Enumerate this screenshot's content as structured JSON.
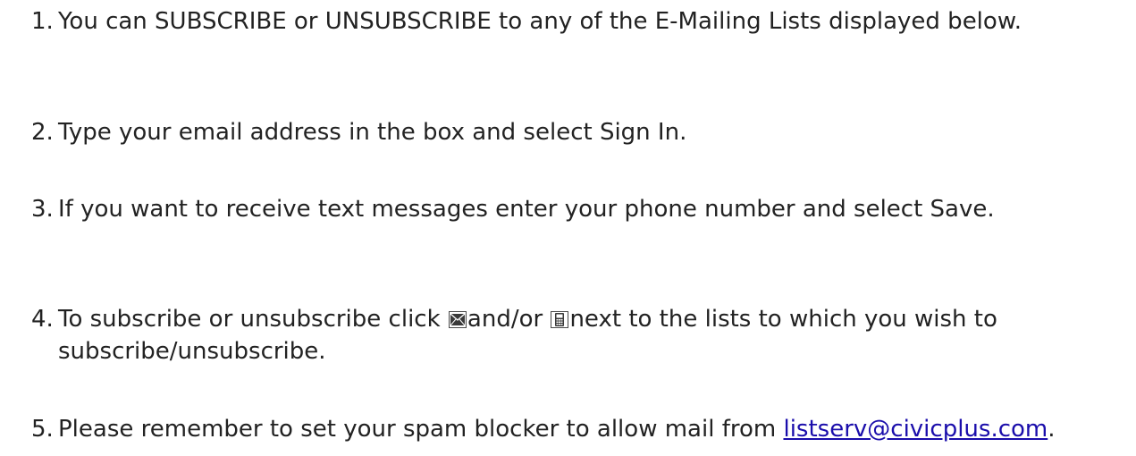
{
  "steps": [
    {
      "number": "1.",
      "text": "You can SUBSCRIBE or UNSUBSCRIBE to any of the E-Mailing Lists displayed below."
    },
    {
      "number": "2.",
      "text": "Type your email address in the box and select Sign In."
    },
    {
      "number": "3.",
      "text": "If you want to receive text messages enter your phone number and select Save."
    },
    {
      "number": "4.",
      "text_before": "To subscribe or unsubscribe click ",
      "text_middle": "and/or ",
      "text_after": "next to the lists to which you wish to subscribe/unsubscribe.",
      "icons": [
        "envelope-icon",
        "phone-icon"
      ]
    },
    {
      "number": "5.",
      "text_before": "Please remember to set your spam blocker to allow mail from ",
      "link_text": "listserv@civicplus.com",
      "text_after": "."
    }
  ],
  "colors": {
    "text": "#222222",
    "link": "#1a0dab",
    "icon_border": "#4a4a4a"
  }
}
